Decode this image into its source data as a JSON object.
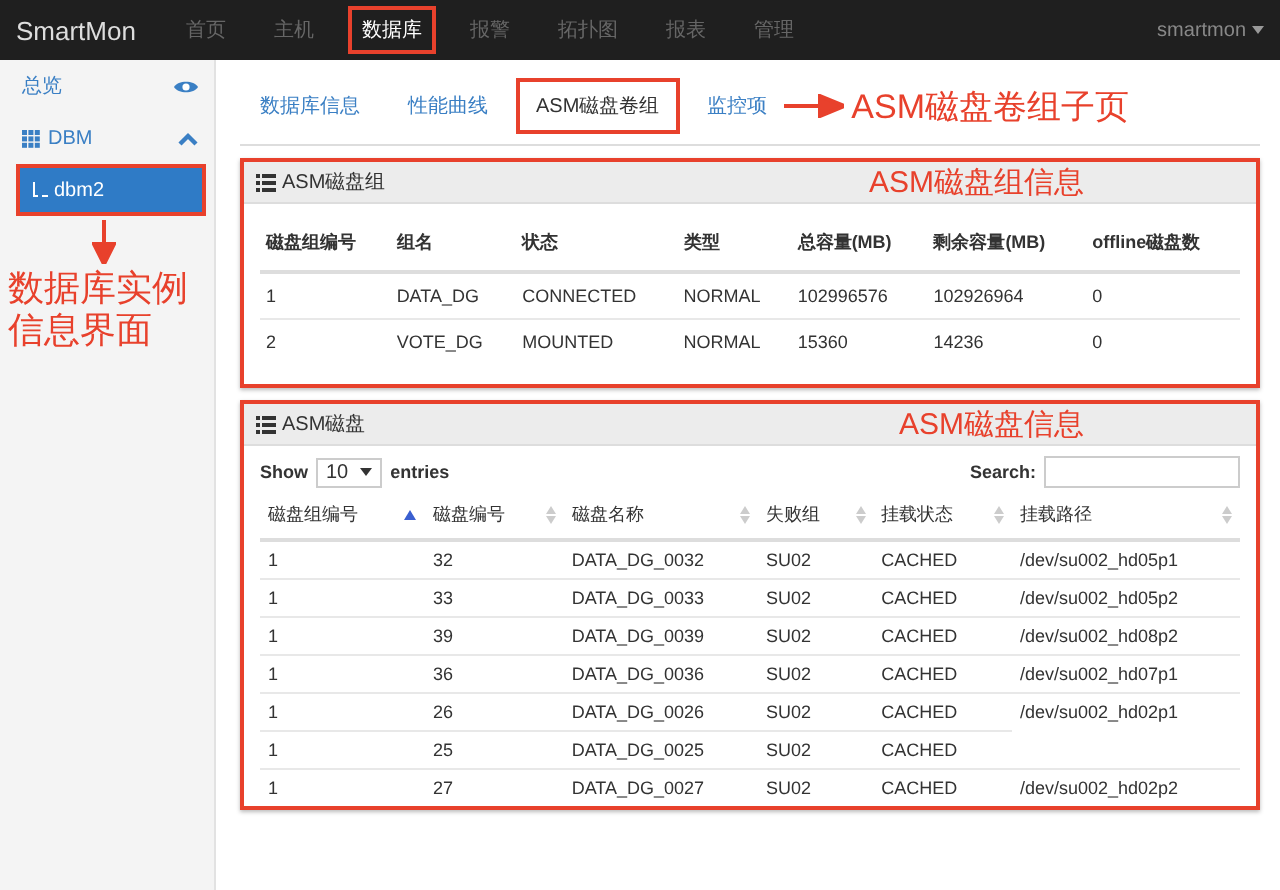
{
  "navbar": {
    "brand": "SmartMon",
    "items": [
      {
        "label": "首页",
        "selected": false
      },
      {
        "label": "主机",
        "selected": false
      },
      {
        "label": "数据库",
        "selected": true
      },
      {
        "label": "报警",
        "selected": false
      },
      {
        "label": "拓扑图",
        "selected": false
      },
      {
        "label": "报表",
        "selected": false
      },
      {
        "label": "管理",
        "selected": false
      }
    ],
    "user": "smartmon"
  },
  "sidebar": {
    "items": [
      {
        "label": "总览",
        "kind": "link"
      },
      {
        "label": "DBM",
        "kind": "group",
        "expanded": true,
        "children": [
          {
            "label": "dbm2",
            "selected": true
          }
        ]
      }
    ],
    "note": "数据库实例信息界面"
  },
  "tabs": [
    {
      "label": "数据库信息",
      "selected": false
    },
    {
      "label": "性能曲线",
      "selected": false
    },
    {
      "label": "ASM磁盘卷组",
      "selected": true
    },
    {
      "label": "监控项",
      "selected": false
    }
  ],
  "tabs_note": "ASM磁盘卷组子页",
  "group_panel": {
    "title": "ASM磁盘组",
    "note": "ASM磁盘组信息",
    "columns": [
      "磁盘组编号",
      "组名",
      "状态",
      "类型",
      "总容量(MB)",
      "剩余容量(MB)",
      "offline磁盘数"
    ],
    "rows": [
      [
        "1",
        "DATA_DG",
        "CONNECTED",
        "NORMAL",
        "102996576",
        "102926964",
        "0"
      ],
      [
        "2",
        "VOTE_DG",
        "MOUNTED",
        "NORMAL",
        "15360",
        "14236",
        "0"
      ]
    ]
  },
  "disk_panel": {
    "title": "ASM磁盘",
    "note": "ASM磁盘信息",
    "show_label": "Show",
    "page_size": "10",
    "entries_label": "entries",
    "search_label": "Search:",
    "columns": [
      {
        "label": "磁盘组编号",
        "selected": true
      },
      {
        "label": "磁盘编号",
        "selected": false
      },
      {
        "label": "磁盘名称",
        "selected": false
      },
      {
        "label": "失败组",
        "selected": false
      },
      {
        "label": "挂载状态",
        "selected": false
      },
      {
        "label": "挂载路径",
        "selected": false
      }
    ],
    "rows": [
      [
        "1",
        "32",
        "DATA_DG_0032",
        "SU02",
        "CACHED",
        "/dev/su002_hd05p1"
      ],
      [
        "1",
        "33",
        "DATA_DG_0033",
        "SU02",
        "CACHED",
        "/dev/su002_hd05p2"
      ],
      [
        "1",
        "39",
        "DATA_DG_0039",
        "SU02",
        "CACHED",
        "/dev/su002_hd08p2"
      ],
      [
        "1",
        "36",
        "DATA_DG_0036",
        "SU02",
        "CACHED",
        "/dev/su002_hd07p1"
      ],
      [
        "1",
        "26",
        "DATA_DG_0026",
        "SU02",
        "CACHED",
        "/dev/su002_hd02p1"
      ],
      [
        "1",
        "25",
        "DATA_DG_0025",
        "SU02",
        "CACHED"
      ],
      [
        "1",
        "27",
        "DATA_DG_0027",
        "SU02",
        "CACHED",
        "/dev/su002_hd02p2"
      ]
    ]
  }
}
